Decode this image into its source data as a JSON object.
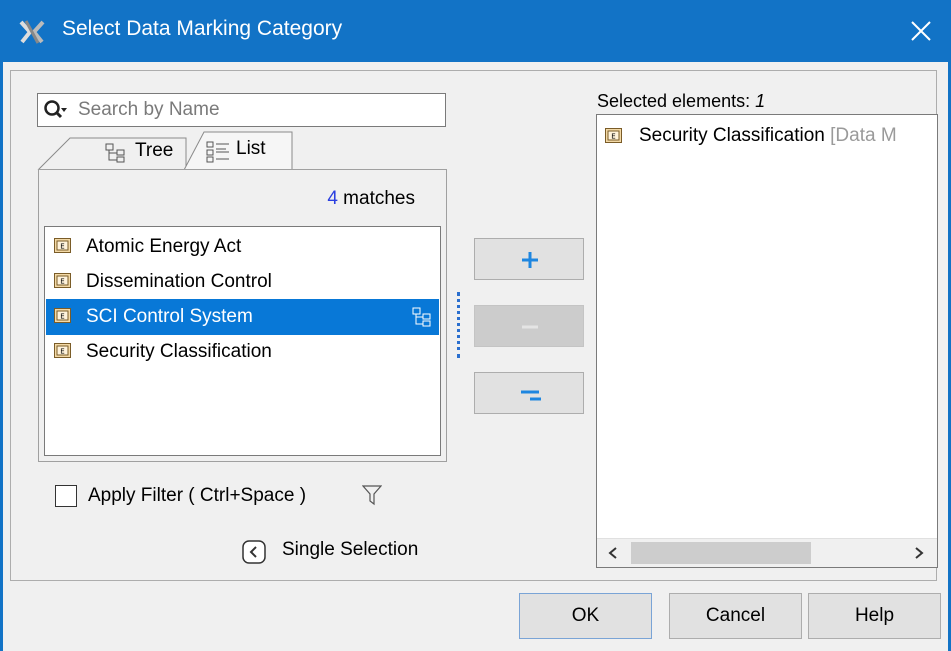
{
  "window": {
    "title": "Select Data Marking Category",
    "accent": "#1273c6",
    "app_icon": "magicdraw-app-icon",
    "close_icon": "close-icon"
  },
  "search": {
    "placeholder": "Search by Name"
  },
  "tabs": [
    {
      "label": "Tree",
      "icon": "tree-icon",
      "active": false
    },
    {
      "label": "List",
      "icon": "list-icon",
      "active": true
    }
  ],
  "results": {
    "count": "4",
    "suffix": " matches",
    "items": [
      {
        "label": "Atomic Energy Act",
        "selected": false
      },
      {
        "label": "Dissemination Control",
        "selected": false
      },
      {
        "label": "SCI Control System",
        "selected": true
      },
      {
        "label": "Security Classification",
        "selected": false
      }
    ]
  },
  "filter": {
    "label": "Apply Filter ( Ctrl+Space )",
    "checked": false
  },
  "mode": {
    "label": "Single Selection"
  },
  "transfer": {
    "add": "plus",
    "remove": "minus",
    "remove_all": "minus-all"
  },
  "selected": {
    "label": "Selected elements: ",
    "count": "1",
    "items": [
      {
        "name": "Security Classification",
        "meta": " [Data M"
      }
    ]
  },
  "buttons": {
    "ok": "OK",
    "cancel": "Cancel",
    "help": "Help"
  }
}
